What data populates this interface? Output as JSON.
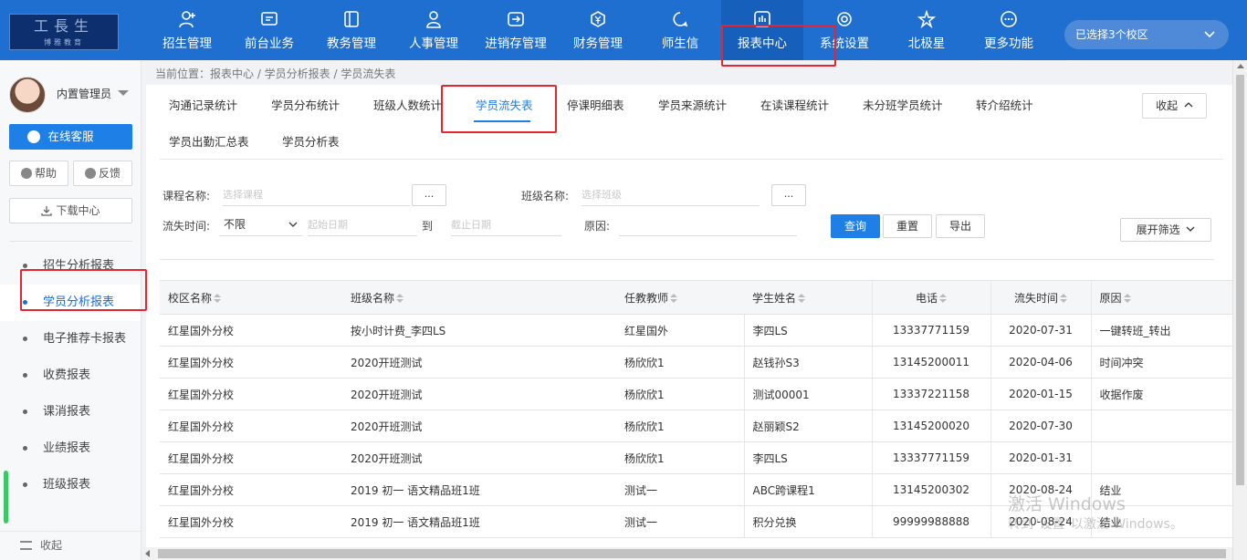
{
  "brand": {
    "logo_top": "工長生",
    "logo_bottom": "博雅教育"
  },
  "topnav": [
    {
      "label": "招生管理",
      "icon": "user-add-icon"
    },
    {
      "label": "前台业务",
      "icon": "monitor-icon"
    },
    {
      "label": "教务管理",
      "icon": "book-icon"
    },
    {
      "label": "人事管理",
      "icon": "person-icon"
    },
    {
      "label": "进销存管理",
      "icon": "inventory-icon"
    },
    {
      "label": "财务管理",
      "icon": "money-icon"
    },
    {
      "label": "师生信",
      "icon": "chat-icon"
    },
    {
      "label": "报表中心",
      "icon": "report-icon"
    },
    {
      "label": "系统设置",
      "icon": "settings-icon"
    },
    {
      "label": "北极星",
      "icon": "star-icon"
    },
    {
      "label": "更多功能",
      "icon": "more-icon"
    }
  ],
  "campus_selector": "已选择3个校区",
  "sidebar": {
    "username": "内置管理员",
    "online_service": "在线客服",
    "help": "帮助",
    "feedback": "反馈",
    "download": "下载中心",
    "items": [
      "招生分析报表",
      "学员分析报表",
      "电子推荐卡报表",
      "收费报表",
      "课消报表",
      "业绩报表",
      "班级报表"
    ],
    "collapse": "收起"
  },
  "breadcrumb": "当前位置：报表中心 / 学员分析报表 / 学员流失表",
  "tabs_row1": [
    "沟通记录统计",
    "学员分布统计",
    "班级人数统计",
    "学员流失表",
    "停课明细表",
    "学员来源统计",
    "在读课程统计",
    "未分班学员统计",
    "转介绍统计"
  ],
  "tabs_row2": [
    "学员出勤汇总表",
    "学员分析表"
  ],
  "collapse_tabs": "收起",
  "filters": {
    "course_label": "课程名称:",
    "course_placeholder": "选择课程",
    "class_label": "班级名称:",
    "class_placeholder": "选择班级",
    "dots": "...",
    "time_label": "流失时间:",
    "time_value": "不限",
    "start_placeholder": "起始日期",
    "to": "到",
    "end_placeholder": "截止日期",
    "reason_label": "原因:",
    "query": "查询",
    "reset": "重置",
    "export": "导出",
    "expand": "展开筛选"
  },
  "table": {
    "headers": [
      "校区名称",
      "班级名称",
      "任教教师",
      "学生姓名",
      "电话",
      "流失时间",
      "原因"
    ],
    "rows": [
      [
        "红星国外分校",
        "按小时计费_李四LS",
        "红星国外",
        "李四LS",
        "13337771159",
        "2020-07-31",
        "一键转班_转出"
      ],
      [
        "红星国外分校",
        "2020开班测试",
        "杨欣欣1",
        "赵钱孙S3",
        "13145200011",
        "2020-04-06",
        "时间冲突"
      ],
      [
        "红星国外分校",
        "2020开班测试",
        "杨欣欣1",
        "测试00001",
        "13337221158",
        "2020-01-15",
        "收据作废"
      ],
      [
        "红星国外分校",
        "2020开班测试",
        "杨欣欣1",
        "赵丽颖S2",
        "13145200020",
        "2020-07-30",
        ""
      ],
      [
        "红星国外分校",
        "2020开班测试",
        "杨欣欣1",
        "李四LS",
        "13337771159",
        "2020-01-31",
        ""
      ],
      [
        "红星国外分校",
        "2019 初一 语文精品班1班",
        "测试一",
        "ABC跨课程1",
        "13145200302",
        "2020-08-24",
        "结业"
      ],
      [
        "红星国外分校",
        "2019 初一 语文精品班1班",
        "测试一",
        "积分兑换",
        "99999988888",
        "2020-08-24",
        "结业"
      ]
    ]
  },
  "watermark": {
    "line1": "激活 Windows",
    "line2": "转到\"设置\"以激活 Windows。"
  },
  "colors": {
    "nav_bg": "#1e6fcf",
    "accent": "#1e7fe6",
    "highlight": "#e8242f"
  }
}
